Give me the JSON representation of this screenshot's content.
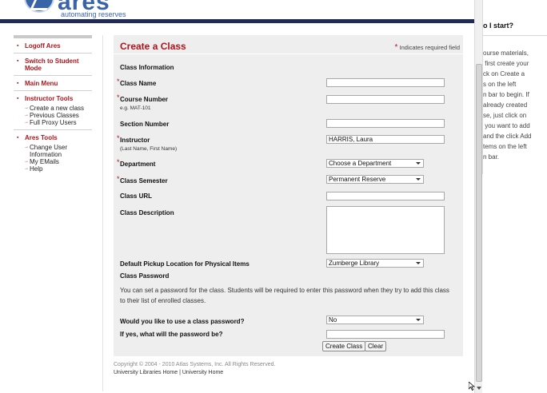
{
  "header": {
    "logo_word": "ares",
    "logo_tagline": "automating reserves"
  },
  "sidebar": {
    "logoff": "Logoff Ares",
    "switch_student": "Switch to Student Mode",
    "main_menu": "Main Menu",
    "instructor_tools": "Instructor Tools",
    "instructor_items": [
      "Create a new class",
      "Previous Classes",
      "Full Proxy Users"
    ],
    "ares_tools": "Ares Tools",
    "ares_items": [
      "Change User Information",
      "My EMails",
      "Help"
    ]
  },
  "form": {
    "title": "Create a Class",
    "required_note": "Indicates required field",
    "section_class_info": "Class Information",
    "class_name_label": "Class Name",
    "course_number_label": "Course Number",
    "course_number_hint": "e.g. MAT-101",
    "section_number_label": "Section Number",
    "instructor_label": "Instructor",
    "instructor_hint": "(Last Name, First Name)",
    "instructor_value": "HARRIS, Laura",
    "department_label": "Department",
    "department_value": "Choose a Department",
    "semester_label": "Class Semester",
    "semester_value": "Permanent Reserve",
    "url_label": "Class URL",
    "description_label": "Class Description",
    "pickup_label": "Default Pickup Location for Physical Items",
    "pickup_value": "Zumberge Library",
    "section_password": "Class Password",
    "password_desc": "You can set a password for the class. Students will be required to enter this password when they try to add this class to their list of enrolled classes.",
    "use_password_label": "Would you like to use a class password?",
    "use_password_value": "No",
    "password_label": "If yes, what will the password be?",
    "create_button": "Create Class",
    "clear_button": "Clear"
  },
  "footer": {
    "copyright": "Copyright © 2004 - 2010 Atlas Systems, Inc. All Rights Reserved.",
    "links": "University Libraries Home | University Home"
  },
  "help": {
    "title": "o I start?",
    "body": "ourse materials,\n first create your\nck on Create a\ns on the left\nn bar to begin. If\nalready created\nse, just click on\n you want to add\nand the click Add\ntems on the left\nn bar."
  },
  "colors": {
    "accent_red": "#b0151d",
    "header_bar": "#202a57",
    "logo_blue": "#3a64a8",
    "panel_bg": "#eeeeee"
  }
}
